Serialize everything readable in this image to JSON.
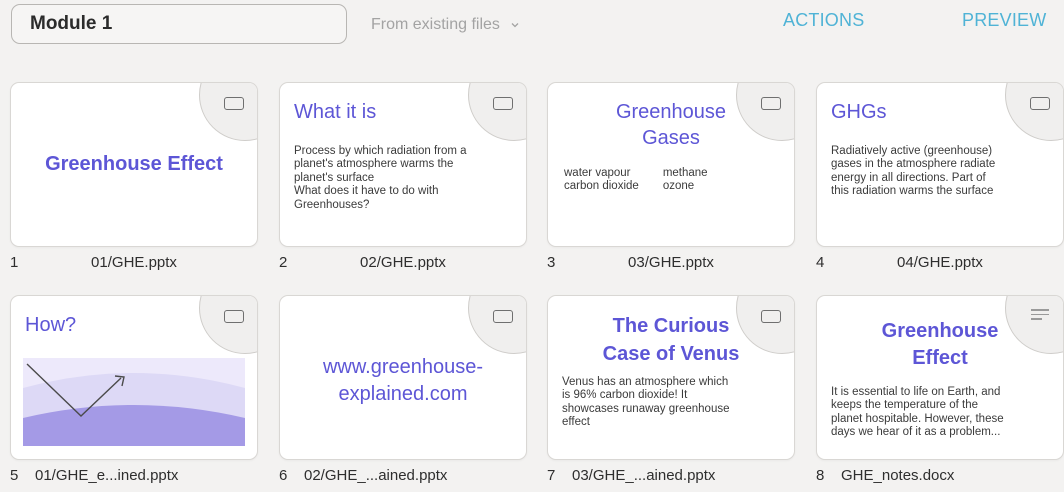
{
  "topbar": {
    "module_name": "Module 1",
    "source_select": "From existing files",
    "actions_label": "ACTIONS",
    "preview_label": "PREVIEW"
  },
  "tiles": [
    {
      "number": "1",
      "file": "01/GHE.pptx",
      "type_icon": "slide-icon",
      "title": "Greenhouse Effect"
    },
    {
      "number": "2",
      "file": "02/GHE.pptx",
      "type_icon": "slide-icon",
      "title": "What it is",
      "lines": [
        "Process by which radiation from a",
        "planet's atmosphere warms the",
        "planet's surface",
        "What does it have to do with",
        "Greenhouses?"
      ]
    },
    {
      "number": "3",
      "file": "03/GHE.pptx",
      "type_icon": "slide-icon",
      "title_lines": [
        "Greenhouse",
        "Gases"
      ],
      "col1": [
        "water vapour",
        "carbon dioxide"
      ],
      "col2": [
        "methane",
        "ozone"
      ]
    },
    {
      "number": "4",
      "file": "04/GHE.pptx",
      "type_icon": "slide-icon",
      "title": "GHGs",
      "lines": [
        "Radiatively active (greenhouse)",
        "gases in the atmosphere radiate",
        "energy in all directions. Part of",
        "this radiation warms the surface"
      ]
    },
    {
      "number": "5",
      "file": "01/GHE_e...ined.pptx",
      "type_icon": "slide-icon",
      "title": "How?"
    },
    {
      "number": "6",
      "file": "02/GHE_...ained.pptx",
      "type_icon": "slide-icon",
      "title_lines": [
        "www.greenhouse-",
        "explained.com"
      ]
    },
    {
      "number": "7",
      "file": "03/GHE_...ained.pptx",
      "type_icon": "slide-icon",
      "title_lines": [
        "The Curious",
        "Case of Venus"
      ],
      "lines": [
        "Venus has an atmosphere which",
        "is 96% carbon dioxide! It",
        "showcases runaway greenhouse",
        "effect"
      ]
    },
    {
      "number": "8",
      "file": "GHE_notes.docx",
      "type_icon": "document-icon",
      "title_lines": [
        "Greenhouse",
        "Effect"
      ],
      "lines": [
        "It is essential to life on Earth, and",
        "keeps the temperature of the",
        "planet hospitable. However, these",
        "days we hear of it as a problem..."
      ]
    }
  ],
  "colors": {
    "accent_link": "#4fb3d6",
    "slide_title": "#5d56d6",
    "illustration_light": "#ddd9f6",
    "illustration_dark": "#a49ae6"
  }
}
